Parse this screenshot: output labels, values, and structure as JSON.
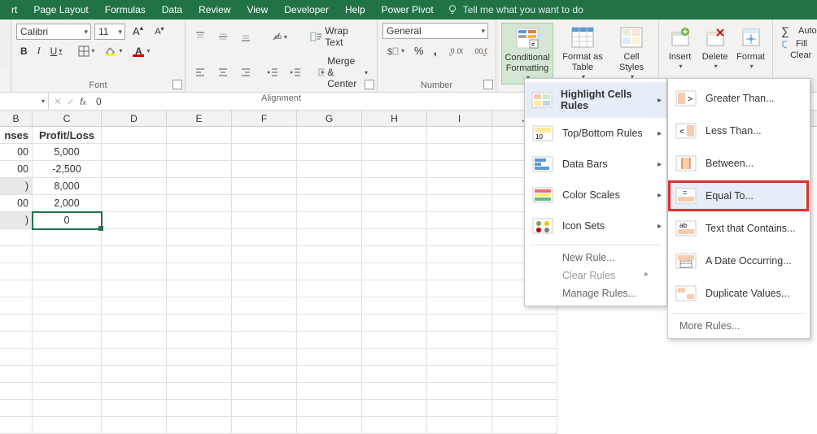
{
  "menubar": {
    "items": [
      "rt",
      "Page Layout",
      "Formulas",
      "Data",
      "Review",
      "View",
      "Developer",
      "Help",
      "Power Pivot"
    ],
    "tellme": "Tell me what you want to do"
  },
  "ribbon": {
    "font": {
      "name": "Calibri",
      "size": "11",
      "label": "Font"
    },
    "alignment": {
      "wrap": "Wrap Text",
      "merge": "Merge & Center",
      "label": "Alignment"
    },
    "number": {
      "format": "General",
      "label": "Number"
    },
    "styles": {
      "cf": "Conditional Formatting",
      "fat": "Format as Table",
      "cs": "Cell Styles"
    },
    "cells": {
      "ins": "Insert",
      "del": "Delete",
      "fmt": "Format"
    },
    "editing": {
      "auto": "Auto",
      "fill": "Fill",
      "clear": "Clear"
    }
  },
  "fx": {
    "name": "",
    "value": "0"
  },
  "grid": {
    "cols": [
      "B",
      "C",
      "D",
      "E",
      "F",
      "G",
      "H",
      "I",
      "J"
    ],
    "widthsB": 40,
    "header": {
      "b": "nses",
      "c": "Profit/Loss"
    },
    "rows": [
      {
        "b": "00",
        "c": "5,000"
      },
      {
        "b": "00",
        "c": "-2,500"
      },
      {
        "b": ")",
        "c": "8,000",
        "grayB": true
      },
      {
        "b": "00",
        "c": "2,000"
      },
      {
        "b": ")",
        "c": "0",
        "grayB": true,
        "selC": true
      }
    ]
  },
  "cfmenu": {
    "items": [
      {
        "label": "Highlight Cells Rules",
        "hover": true
      },
      {
        "label": "Top/Bottom Rules"
      },
      {
        "label": "Data Bars"
      },
      {
        "label": "Color Scales"
      },
      {
        "label": "Icon Sets"
      }
    ],
    "plain": [
      "New Rule...",
      "Clear Rules",
      "Manage Rules..."
    ]
  },
  "submenu": {
    "items": [
      "Greater Than...",
      "Less Than...",
      "Between...",
      "Equal To...",
      "Text that Contains...",
      "A Date Occurring...",
      "Duplicate Values..."
    ],
    "more": "More Rules...",
    "highlight": 3
  }
}
